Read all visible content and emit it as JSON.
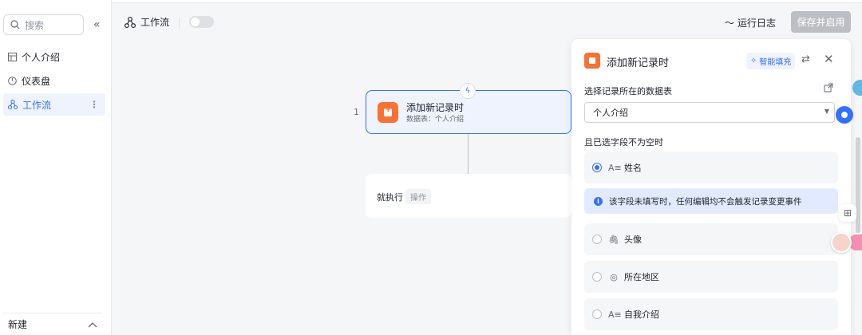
{
  "sidebar": {
    "search_placeholder": "搜索",
    "collapse_icon": "double-chevron-left-icon",
    "items": [
      {
        "label": "个人介绍",
        "icon": "table-icon"
      },
      {
        "label": "仪表盘",
        "icon": "dashboard-icon"
      },
      {
        "label": "工作流",
        "icon": "workflow-icon",
        "active": true
      }
    ],
    "new_label": "新建"
  },
  "header": {
    "title": "工作流",
    "run_log": "运行日志",
    "save_enable": "保存并启用"
  },
  "canvas": {
    "node_index": "1",
    "trigger": {
      "title": "添加新记录时",
      "subtitle": "数据表：个人介绍"
    },
    "action": {
      "label": "就执行",
      "tag": "操作"
    }
  },
  "panel": {
    "title": "添加新记录时",
    "smart_fill": "智能填充",
    "table_label": "选择记录所在的数据表",
    "table_value": "个人介绍",
    "field_label": "且已选字段不为空时",
    "fields": [
      {
        "name": "姓名",
        "icon": "text-icon",
        "checked": true
      },
      {
        "name": "头像",
        "icon": "attachment-icon",
        "checked": false
      },
      {
        "name": "所在地区",
        "icon": "location-icon",
        "checked": false
      },
      {
        "name": "自我介绍",
        "icon": "text-icon",
        "checked": false
      }
    ],
    "notice": "该字段未填写时，任何编辑均不会触发记录变更事件"
  },
  "colors": {
    "accent": "#3370ff",
    "node_orange": "#f77234",
    "disabled_btn": "#bbbfc4"
  }
}
